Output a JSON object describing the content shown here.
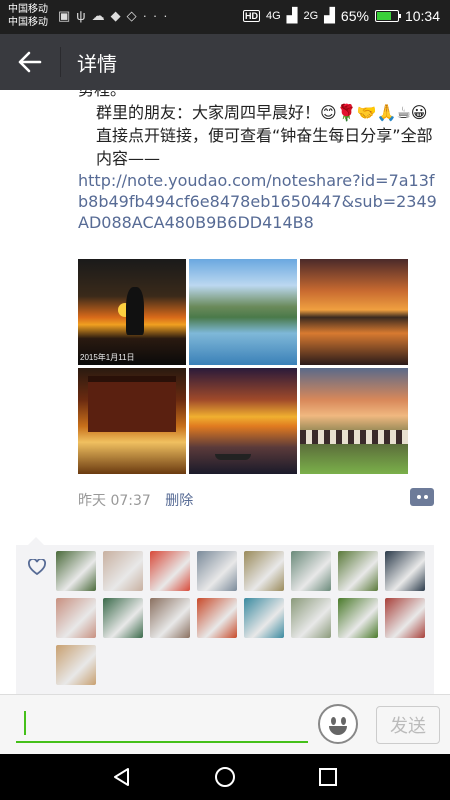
{
  "status_bar": {
    "carrier_line1": "中国移动",
    "carrier_line2": "中国移动",
    "hd": "HD",
    "signal1": "4G",
    "signal2": "2G",
    "battery": "65%",
    "battery_level": 0.65,
    "time": "10:34"
  },
  "nav": {
    "title": "详情"
  },
  "post": {
    "line_top": "勇程。",
    "greeting": "群里的朋友：大家周四早晨好！😊🌹🤝🙏☕😀",
    "instruction": "直接点开链接，便可查看“钟奋生每日分享”全部内容——",
    "link": "http://note.youdao.com/noteshare?id=7a13fb8b49fb494cf6e8478eb1650447&sub=2349AD088ACA480B9B6DD414B8",
    "photo_date": "2015年1月11日",
    "time": "昨天 07:37",
    "delete": "删除"
  },
  "likes": {
    "avatar_colors": [
      "#4a6a3a",
      "#c8b0a0",
      "#d84a3a",
      "#7a8a9a",
      "#9a8a5a",
      "#6a8a7a",
      "#5a7a3a",
      "#2a3a4a",
      "#c89080",
      "#3a6a4a",
      "#8a7060",
      "#c84a2a",
      "#3a8aa0",
      "#8a9a7a",
      "#4a7a2a",
      "#a8403a",
      "#c8a070"
    ]
  },
  "input": {
    "placeholder": "",
    "send": "发送"
  }
}
